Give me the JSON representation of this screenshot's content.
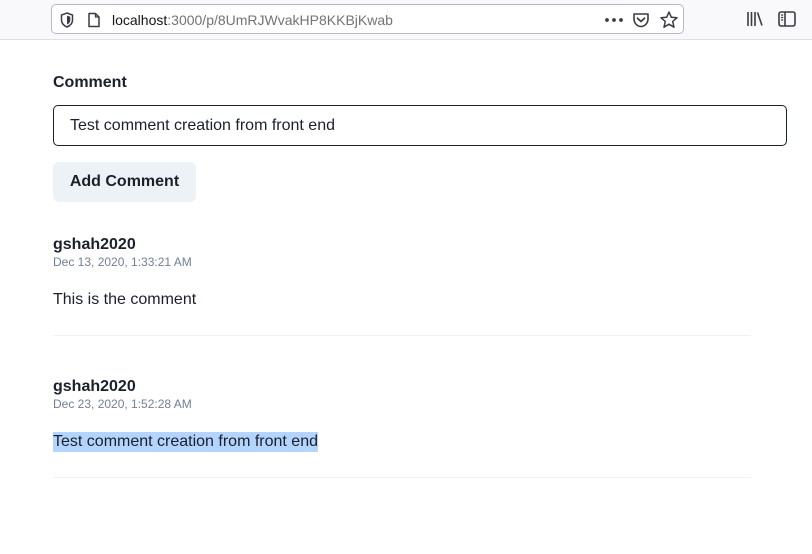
{
  "browser": {
    "url_host": "localhost",
    "url_path": ":3000/p/8UmRJWvakHP8KKBjKwab"
  },
  "form": {
    "label": "Comment",
    "input_value": "Test comment creation from front end",
    "submit_label": "Add Comment"
  },
  "comments": [
    {
      "author": "gshah2020",
      "date": "Dec 13, 2020, 1:33:21 AM",
      "body": "This is the comment"
    },
    {
      "author": "gshah2020",
      "date": "Dec 23, 2020, 1:52:28 AM",
      "body": "Test comment creation from front end",
      "selected": true
    }
  ]
}
